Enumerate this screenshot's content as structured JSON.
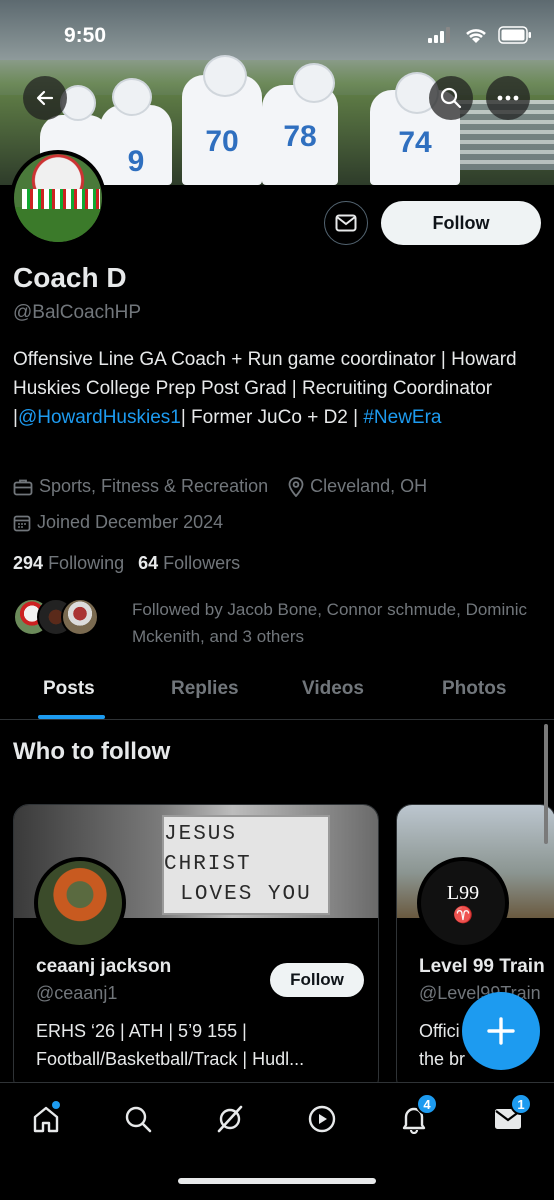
{
  "status_bar": {
    "time": "9:50"
  },
  "profile": {
    "name": "Coach D",
    "handle": "@BalCoachHP",
    "follow_label": "Follow",
    "bio_prefix": "Offensive Line GA Coach + Run game coordinator | Howard Huskies College Prep Post Grad | Recruiting Coordinator |",
    "bio_mention": "@HowardHuskies1",
    "bio_middle": "| Former JuCo + D2 |",
    "bio_hashtag": "#NewEra",
    "category": "Sports, Fitness & Recreation",
    "location": "Cleveland, OH",
    "joined": "Joined December 2024",
    "following_count": "294",
    "following_label": "Following",
    "followers_count": "64",
    "followers_label": "Followers",
    "followed_by": "Followed by Jacob Bone, Connor schmude, Dominic Mckenith, and 3 others"
  },
  "banner_jersey_numbers": [
    "9",
    "70",
    "78",
    "74"
  ],
  "tabs": [
    {
      "label": "Posts",
      "active": true
    },
    {
      "label": "Replies",
      "active": false
    },
    {
      "label": "Videos",
      "active": false
    },
    {
      "label": "Photos",
      "active": false
    }
  ],
  "who_to_follow": {
    "title": "Who to follow",
    "cards": [
      {
        "name": "ceaanj jackson",
        "handle": "@ceaanj1",
        "bio_line1": "ERHS ‘26 | ATH | 5’9 155 |",
        "bio_line2": "Football/Basketball/Track | Hudl...",
        "follow_label": "Follow",
        "banner_sign_line1": "JESUS CHRIST",
        "banner_sign_line2": "LOVES YOU"
      },
      {
        "name": "Level 99 Train",
        "handle": "@Level99Train",
        "bio_line1": "Offici",
        "bio_line2": "the br",
        "avatar_text": "L99"
      }
    ]
  },
  "bottom_nav": {
    "notifications_badge": "4",
    "messages_badge": "1"
  },
  "colors": {
    "accent": "#1d9bf0",
    "background": "#000000",
    "muted": "#71767b",
    "text": "#e7e9ea"
  }
}
